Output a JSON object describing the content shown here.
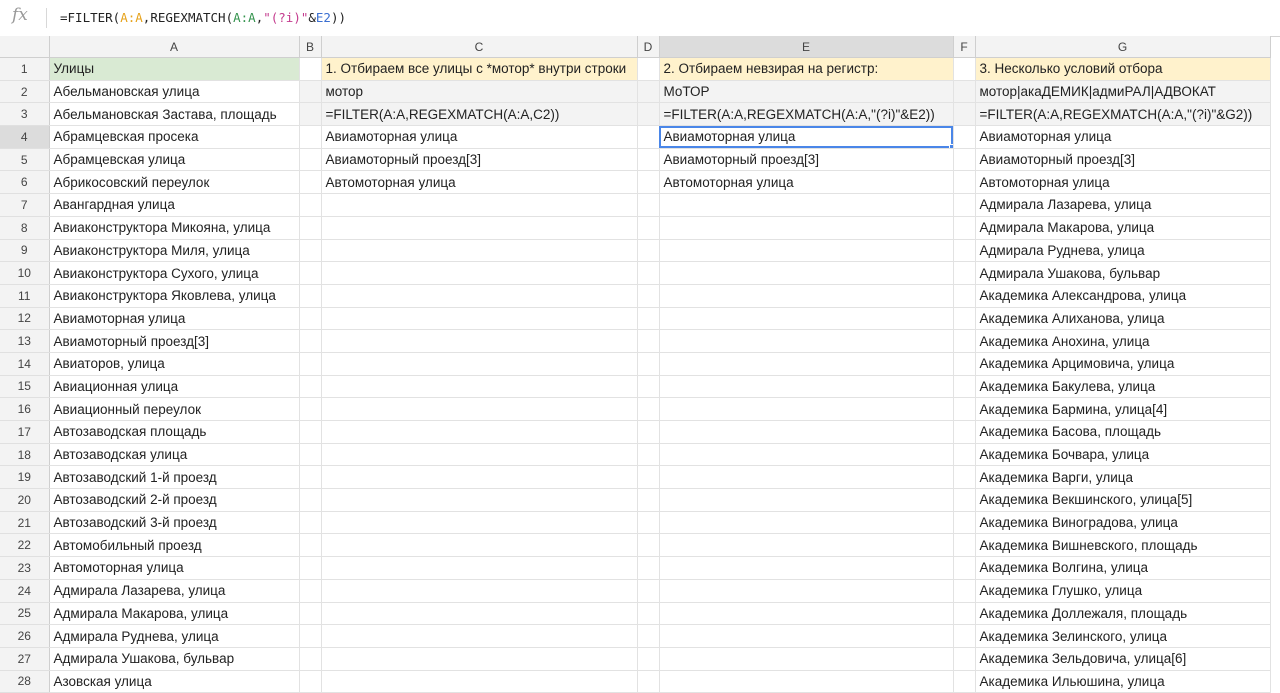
{
  "formula_bar": {
    "icon": "fx-icon",
    "parts": [
      "=FILTER(",
      "A:A",
      ",REGEXMATCH(",
      "A:A",
      ",",
      "\"(?i)\"",
      "&",
      "E2",
      "))"
    ]
  },
  "columns": [
    "A",
    "B",
    "C",
    "D",
    "E",
    "F",
    "G"
  ],
  "rows": [
    {
      "n": "1",
      "a": "Улицы",
      "c": "1. Отбираем все улицы с *мотор* внутри строки",
      "e": "2. Отбираем невзирая на регистр:",
      "g": "3. Несколько условий отбора"
    },
    {
      "n": "2",
      "a": "Абельмановская улица",
      "c": "мотор",
      "e": "МоТОР",
      "g": "мотор|акаДЕМИК|адмиРАЛ|АДВОКАТ"
    },
    {
      "n": "3",
      "a": "Абельмановская Застава, площадь",
      "c": "=FILTER(A:A,REGEXMATCH(A:A,C2))",
      "e": "=FILTER(A:A,REGEXMATCH(A:A,\"(?i)\"&E2))",
      "g": "=FILTER(A:A,REGEXMATCH(A:A,\"(?i)\"&G2))"
    },
    {
      "n": "4",
      "a": "Абрамцевская просека",
      "c": "Авиамоторная улица",
      "e": "Авиамоторная улица",
      "g": "Авиамоторная улица"
    },
    {
      "n": "5",
      "a": "Абрамцевская улица",
      "c": "Авиамоторный проезд[3]",
      "e": "Авиамоторный проезд[3]",
      "g": "Авиамоторный проезд[3]"
    },
    {
      "n": "6",
      "a": "Абрикосовский переулок",
      "c": "Автомоторная улица",
      "e": "Автомоторная улица",
      "g": "Автомоторная улица"
    },
    {
      "n": "7",
      "a": "Авангардная улица",
      "c": "",
      "e": "",
      "g": "Адмирала Лазарева, улица"
    },
    {
      "n": "8",
      "a": "Авиаконструктора Микояна, улица",
      "c": "",
      "e": "",
      "g": "Адмирала Макарова, улица"
    },
    {
      "n": "9",
      "a": "Авиаконструктора Миля, улица",
      "c": "",
      "e": "",
      "g": "Адмирала Руднева, улица"
    },
    {
      "n": "10",
      "a": "Авиаконструктора Сухого, улица",
      "c": "",
      "e": "",
      "g": "Адмирала Ушакова, бульвар"
    },
    {
      "n": "11",
      "a": "Авиаконструктора Яковлева, улица",
      "c": "",
      "e": "",
      "g": "Академика Александрова, улица"
    },
    {
      "n": "12",
      "a": "Авиамоторная улица",
      "c": "",
      "e": "",
      "g": "Академика Алиханова, улица"
    },
    {
      "n": "13",
      "a": "Авиамоторный проезд[3]",
      "c": "",
      "e": "",
      "g": "Академика Анохина, улица"
    },
    {
      "n": "14",
      "a": "Авиаторов, улица",
      "c": "",
      "e": "",
      "g": "Академика Арцимовича, улица"
    },
    {
      "n": "15",
      "a": "Авиационная улица",
      "c": "",
      "e": "",
      "g": "Академика Бакулева, улица"
    },
    {
      "n": "16",
      "a": "Авиационный переулок",
      "c": "",
      "e": "",
      "g": "Академика Бармина, улица[4]"
    },
    {
      "n": "17",
      "a": "Автозаводская площадь",
      "c": "",
      "e": "",
      "g": "Академика Басова, площадь"
    },
    {
      "n": "18",
      "a": "Автозаводская улица",
      "c": "",
      "e": "",
      "g": "Академика Бочвара, улица"
    },
    {
      "n": "19",
      "a": "Автозаводский 1-й проезд",
      "c": "",
      "e": "",
      "g": "Академика Варги, улица"
    },
    {
      "n": "20",
      "a": "Автозаводский 2-й проезд",
      "c": "",
      "e": "",
      "g": "Академика Векшинского, улица[5]"
    },
    {
      "n": "21",
      "a": "Автозаводский 3-й проезд",
      "c": "",
      "e": "",
      "g": "Академика Виноградова, улица"
    },
    {
      "n": "22",
      "a": "Автомобильный проезд",
      "c": "",
      "e": "",
      "g": "Академика Вишневского, площадь"
    },
    {
      "n": "23",
      "a": "Автомоторная улица",
      "c": "",
      "e": "",
      "g": "Академика Волгина, улица"
    },
    {
      "n": "24",
      "a": "Адмирала Лазарева, улица",
      "c": "",
      "e": "",
      "g": "Академика Глушко, улица"
    },
    {
      "n": "25",
      "a": "Адмирала Макарова, улица",
      "c": "",
      "e": "",
      "g": "Академика Доллежаля, площадь"
    },
    {
      "n": "26",
      "a": "Адмирала Руднева, улица",
      "c": "",
      "e": "",
      "g": "Академика Зелинского, улица"
    },
    {
      "n": "27",
      "a": "Адмирала Ушакова, бульвар",
      "c": "",
      "e": "",
      "g": "Академика Зельдовича, улица[6]"
    },
    {
      "n": "28",
      "a": "Азовская улица",
      "c": "",
      "e": "",
      "g": "Академика Ильюшина, улица"
    }
  ],
  "colors": {
    "header_green": "#d9ead3",
    "header_yellow": "#fff2cc",
    "selection": "#4a86e8"
  },
  "selected_cell": "E4"
}
